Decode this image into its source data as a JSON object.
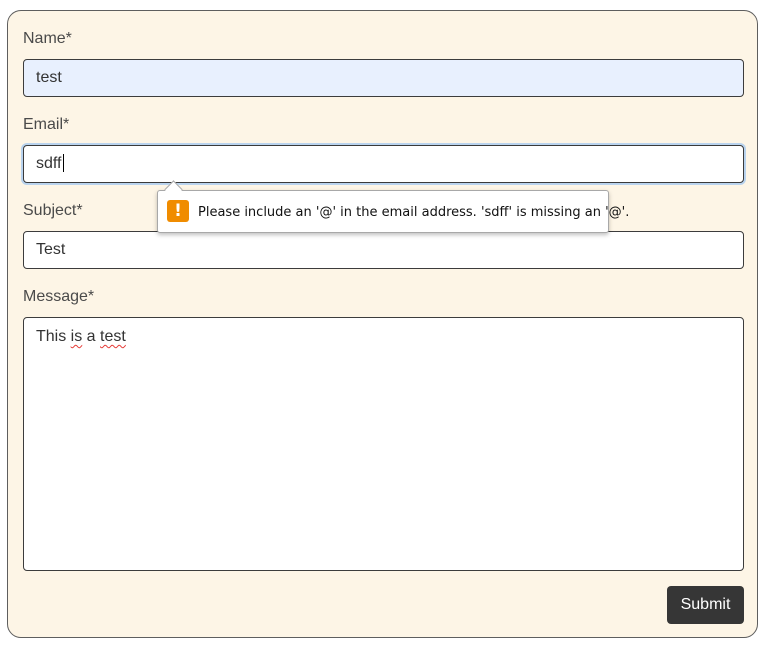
{
  "form": {
    "name_label": "Name*",
    "name_value": "test",
    "email_label": "Email*",
    "email_value": "sdff",
    "subject_label": "Subject*",
    "subject_value": "Test",
    "message_label": "Message*",
    "message_words": [
      "This ",
      "is",
      " a ",
      "test"
    ],
    "submit_label": "Submit"
  },
  "validation": {
    "message": "Please include an '@' in the email address. 'sdff' is missing an '@'.",
    "icon": "warning-icon",
    "icon_glyph": "!"
  },
  "colors": {
    "card_background": "#fdf5e6",
    "autofill_background": "#e8f0fe",
    "button_background": "#363636",
    "warning": "#f08c00"
  }
}
